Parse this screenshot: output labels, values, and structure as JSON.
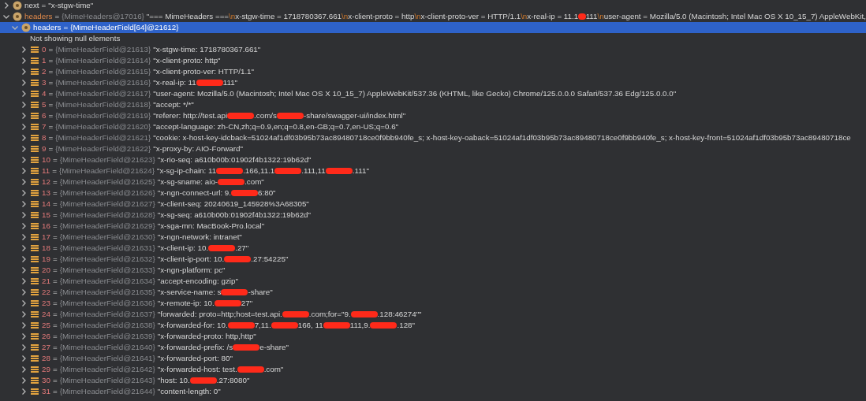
{
  "tree": [
    {
      "name": "next",
      "op": "=",
      "expanded": false,
      "selected": false,
      "value": [
        {
          "kind": "text",
          "text": "\"x-stgw-time\""
        }
      ]
    },
    {
      "name": "headers",
      "op": "=",
      "type": "{MimeHeaders@17016}",
      "expanded": true,
      "selected": false,
      "value": [
        {
          "kind": "text",
          "text": "\"=== MimeHeaders ==="
        },
        {
          "kind": "escape",
          "text": "\\n"
        },
        {
          "kind": "text",
          "text": "x-stgw-time = 1718780367.661"
        },
        {
          "kind": "escape",
          "text": "\\n"
        },
        {
          "kind": "text",
          "text": "x-client-proto = http"
        },
        {
          "kind": "escape",
          "text": "\\n"
        },
        {
          "kind": "text",
          "text": "x-client-proto-ver = HTTP/1.1"
        },
        {
          "kind": "escape",
          "text": "\\n"
        },
        {
          "kind": "text",
          "text": "x-real-ip = 11.1"
        },
        {
          "kind": "redaction"
        },
        {
          "kind": "text",
          "text": "111"
        },
        {
          "kind": "escape",
          "text": "\\n"
        },
        {
          "kind": "text",
          "text": "user-agent = Mozilla/5.0 (Macintosh; Intel Mac OS X 10_15_7) AppleWebKit,"
        }
      ],
      "children": [
        {
          "name": "headers",
          "op": "=",
          "type": "{MimeHeaderField[64]@21612}",
          "expanded": true,
          "selected": true,
          "note": "Not showing null elements",
          "children": [
            {
              "index": "0",
              "op": "=",
              "type": "{MimeHeaderField@21613}",
              "expanded": false,
              "selected": false,
              "value": [
                {
                  "kind": "text",
                  "text": "\"x-stgw-time: 1718780367.661\""
                }
              ]
            },
            {
              "index": "1",
              "op": "=",
              "type": "{MimeHeaderField@21614}",
              "expanded": false,
              "selected": false,
              "value": [
                {
                  "kind": "text",
                  "text": "\"x-client-proto: http\""
                }
              ]
            },
            {
              "index": "2",
              "op": "=",
              "type": "{MimeHeaderField@21615}",
              "expanded": false,
              "selected": false,
              "value": [
                {
                  "kind": "text",
                  "text": "\"x-client-proto-ver: HTTP/1.1\""
                }
              ]
            },
            {
              "index": "3",
              "op": "=",
              "type": "{MimeHeaderField@21616}",
              "expanded": false,
              "selected": false,
              "value": [
                {
                  "kind": "text",
                  "text": "\"x-real-ip: 11"
                },
                {
                  "kind": "redaction"
                },
                {
                  "kind": "text",
                  "text": "111\""
                }
              ]
            },
            {
              "index": "4",
              "op": "=",
              "type": "{MimeHeaderField@21617}",
              "expanded": false,
              "selected": false,
              "value": [
                {
                  "kind": "text",
                  "text": "\"user-agent: Mozilla/5.0 (Macintosh; Intel Mac OS X 10_15_7) AppleWebKit/537.36 (KHTML, like Gecko) Chrome/125.0.0.0 Safari/537.36 Edg/125.0.0.0\""
                }
              ]
            },
            {
              "index": "5",
              "op": "=",
              "type": "{MimeHeaderField@21618}",
              "expanded": false,
              "selected": false,
              "value": [
                {
                  "kind": "text",
                  "text": "\"accept: */*\""
                }
              ]
            },
            {
              "index": "6",
              "op": "=",
              "type": "{MimeHeaderField@21619}",
              "expanded": false,
              "selected": false,
              "value": [
                {
                  "kind": "text",
                  "text": "\"referer: http://test.api"
                },
                {
                  "kind": "redaction"
                },
                {
                  "kind": "text",
                  "text": ".com/s"
                },
                {
                  "kind": "redaction"
                },
                {
                  "kind": "text",
                  "text": "-share/swagger-ui/index.html\""
                }
              ]
            },
            {
              "index": "7",
              "op": "=",
              "type": "{MimeHeaderField@21620}",
              "expanded": false,
              "selected": false,
              "value": [
                {
                  "kind": "text",
                  "text": "\"accept-language: zh-CN,zh;q=0.9,en;q=0.8,en-GB;q=0.7,en-US;q=0.6\""
                }
              ]
            },
            {
              "index": "8",
              "op": "=",
              "type": "{MimeHeaderField@21621}",
              "expanded": false,
              "selected": false,
              "value": [
                {
                  "kind": "text",
                  "text": "\"cookie: x-host-key-idcback=51024af1df03b95b73ac89480718ce0f9bb940fe_s; x-host-key-oaback=51024af1df03b95b73ac89480718ce0f9bb940fe_s; x-host-key-front=51024af1df03b95b73ac89480718ce"
                }
              ]
            },
            {
              "index": "9",
              "op": "=",
              "type": "{MimeHeaderField@21622}",
              "expanded": false,
              "selected": false,
              "value": [
                {
                  "kind": "text",
                  "text": "\"x-proxy-by: AIO-Forward\""
                }
              ]
            },
            {
              "index": "10",
              "op": "=",
              "type": "{MimeHeaderField@21623}",
              "expanded": false,
              "selected": false,
              "value": [
                {
                  "kind": "text",
                  "text": "\"x-rio-seq: a610b00b:01902f4b1322:19b62d\""
                }
              ]
            },
            {
              "index": "11",
              "op": "=",
              "type": "{MimeHeaderField@21624}",
              "expanded": false,
              "selected": false,
              "value": [
                {
                  "kind": "text",
                  "text": "\"x-sg-ip-chain: 11"
                },
                {
                  "kind": "redaction"
                },
                {
                  "kind": "text",
                  "text": ".166,11.1"
                },
                {
                  "kind": "redaction"
                },
                {
                  "kind": "text",
                  "text": ".111,11"
                },
                {
                  "kind": "redaction"
                },
                {
                  "kind": "text",
                  "text": ".111\""
                }
              ]
            },
            {
              "index": "12",
              "op": "=",
              "type": "{MimeHeaderField@21625}",
              "expanded": false,
              "selected": false,
              "value": [
                {
                  "kind": "text",
                  "text": "\"x-sg-sname: aio-"
                },
                {
                  "kind": "redaction"
                },
                {
                  "kind": "text",
                  "text": ".com\""
                }
              ]
            },
            {
              "index": "13",
              "op": "=",
              "type": "{MimeHeaderField@21626}",
              "expanded": false,
              "selected": false,
              "value": [
                {
                  "kind": "text",
                  "text": "\"x-ngn-connect-url: 9."
                },
                {
                  "kind": "redaction"
                },
                {
                  "kind": "text",
                  "text": "6:80\""
                }
              ]
            },
            {
              "index": "14",
              "op": "=",
              "type": "{MimeHeaderField@21627}",
              "expanded": false,
              "selected": false,
              "value": [
                {
                  "kind": "text",
                  "text": "\"x-client-seq: 20240619_145928%3A68305\""
                }
              ]
            },
            {
              "index": "15",
              "op": "=",
              "type": "{MimeHeaderField@21628}",
              "expanded": false,
              "selected": false,
              "value": [
                {
                  "kind": "text",
                  "text": "\"x-sg-seq: a610b00b:01902f4b1322:19b62d\""
                }
              ]
            },
            {
              "index": "16",
              "op": "=",
              "type": "{MimeHeaderField@21629}",
              "expanded": false,
              "selected": false,
              "value": [
                {
                  "kind": "text",
                  "text": "\"x-sga-mn: MacBook-Pro.local\""
                }
              ]
            },
            {
              "index": "17",
              "op": "=",
              "type": "{MimeHeaderField@21630}",
              "expanded": false,
              "selected": false,
              "value": [
                {
                  "kind": "text",
                  "text": "\"x-ngn-network: intranet\""
                }
              ]
            },
            {
              "index": "18",
              "op": "=",
              "type": "{MimeHeaderField@21631}",
              "expanded": false,
              "selected": false,
              "value": [
                {
                  "kind": "text",
                  "text": "\"x-client-ip: 10."
                },
                {
                  "kind": "redaction"
                },
                {
                  "kind": "text",
                  "text": ".27\""
                }
              ]
            },
            {
              "index": "19",
              "op": "=",
              "type": "{MimeHeaderField@21632}",
              "expanded": false,
              "selected": false,
              "value": [
                {
                  "kind": "text",
                  "text": "\"x-client-ip-port: 10."
                },
                {
                  "kind": "redaction"
                },
                {
                  "kind": "text",
                  "text": ".27:54225\""
                }
              ]
            },
            {
              "index": "20",
              "op": "=",
              "type": "{MimeHeaderField@21633}",
              "expanded": false,
              "selected": false,
              "value": [
                {
                  "kind": "text",
                  "text": "\"x-ngn-platform: pc\""
                }
              ]
            },
            {
              "index": "21",
              "op": "=",
              "type": "{MimeHeaderField@21634}",
              "expanded": false,
              "selected": false,
              "value": [
                {
                  "kind": "text",
                  "text": "\"accept-encoding: gzip\""
                }
              ]
            },
            {
              "index": "22",
              "op": "=",
              "type": "{MimeHeaderField@21635}",
              "expanded": false,
              "selected": false,
              "value": [
                {
                  "kind": "text",
                  "text": "\"x-service-name: s"
                },
                {
                  "kind": "redaction"
                },
                {
                  "kind": "text",
                  "text": "-share\""
                }
              ]
            },
            {
              "index": "23",
              "op": "=",
              "type": "{MimeHeaderField@21636}",
              "expanded": false,
              "selected": false,
              "value": [
                {
                  "kind": "text",
                  "text": "\"x-remote-ip: 10."
                },
                {
                  "kind": "redaction"
                },
                {
                  "kind": "text",
                  "text": "27\""
                }
              ]
            },
            {
              "index": "24",
              "op": "=",
              "type": "{MimeHeaderField@21637}",
              "expanded": false,
              "selected": false,
              "value": [
                {
                  "kind": "text",
                  "text": "\"forwarded: proto=http;host=test.api."
                },
                {
                  "kind": "redaction"
                },
                {
                  "kind": "text",
                  "text": ".com;for=\"9."
                },
                {
                  "kind": "redaction"
                },
                {
                  "kind": "text",
                  "text": ".128:46274\"\""
                }
              ]
            },
            {
              "index": "25",
              "op": "=",
              "type": "{MimeHeaderField@21638}",
              "expanded": false,
              "selected": false,
              "value": [
                {
                  "kind": "text",
                  "text": "\"x-forwarded-for: 10."
                },
                {
                  "kind": "redaction"
                },
                {
                  "kind": "text",
                  "text": "7,11."
                },
                {
                  "kind": "redaction"
                },
                {
                  "kind": "text",
                  "text": "166, 11"
                },
                {
                  "kind": "redaction"
                },
                {
                  "kind": "text",
                  "text": "111,9."
                },
                {
                  "kind": "redaction"
                },
                {
                  "kind": "text",
                  "text": ".128\""
                }
              ]
            },
            {
              "index": "26",
              "op": "=",
              "type": "{MimeHeaderField@21639}",
              "expanded": false,
              "selected": false,
              "value": [
                {
                  "kind": "text",
                  "text": "\"x-forwarded-proto: http,http\""
                }
              ]
            },
            {
              "index": "27",
              "op": "=",
              "type": "{MimeHeaderField@21640}",
              "expanded": false,
              "selected": false,
              "value": [
                {
                  "kind": "text",
                  "text": "\"x-forwarded-prefix: /s"
                },
                {
                  "kind": "redaction"
                },
                {
                  "kind": "text",
                  "text": "e-share\""
                }
              ]
            },
            {
              "index": "28",
              "op": "=",
              "type": "{MimeHeaderField@21641}",
              "expanded": false,
              "selected": false,
              "value": [
                {
                  "kind": "text",
                  "text": "\"x-forwarded-port: 80\""
                }
              ]
            },
            {
              "index": "29",
              "op": "=",
              "type": "{MimeHeaderField@21642}",
              "expanded": false,
              "selected": false,
              "value": [
                {
                  "kind": "text",
                  "text": "\"x-forwarded-host: test."
                },
                {
                  "kind": "redaction"
                },
                {
                  "kind": "text",
                  "text": ".com\""
                }
              ]
            },
            {
              "index": "30",
              "op": "=",
              "type": "{MimeHeaderField@21643}",
              "expanded": false,
              "selected": false,
              "value": [
                {
                  "kind": "text",
                  "text": "\"host: 10."
                },
                {
                  "kind": "redaction"
                },
                {
                  "kind": "text",
                  "text": ".27:8080\""
                }
              ]
            },
            {
              "index": "31",
              "op": "=",
              "type": "{MimeHeaderField@21644}",
              "expanded": false,
              "selected": false,
              "value": [
                {
                  "kind": "text",
                  "text": "\"content-length: 0\""
                }
              ]
            }
          ]
        }
      ]
    }
  ]
}
